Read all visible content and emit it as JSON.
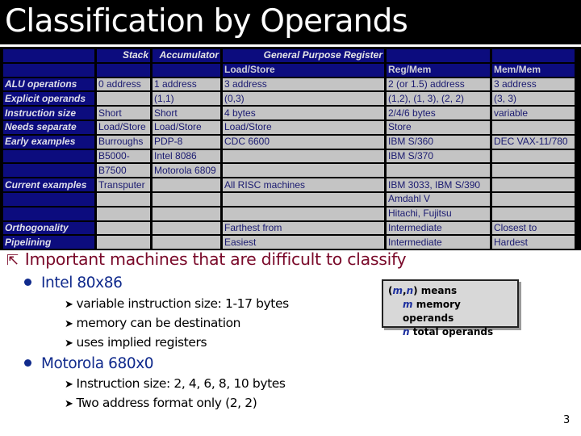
{
  "slide": {
    "title": "Classification by Operands",
    "page_number": "3"
  },
  "table": {
    "group_headers": {
      "stack": "Stack",
      "accumulator": "Accumulator",
      "gpr": "General Purpose Register"
    },
    "sub_headers": {
      "load_store": "Load/Store",
      "reg_mem": "Reg/Mem",
      "mem_mem": "Mem/Mem"
    },
    "rows": [
      {
        "label": "ALU operations",
        "cells": [
          "0 address",
          "1 address",
          "3 address",
          "2 (or 1.5) address",
          "3 address"
        ]
      },
      {
        "label": "Explicit operands",
        "cells": [
          "",
          "(1,1)",
          "(0,3)",
          "(1,2),  (1, 3), (2, 2)",
          "(3, 3)"
        ]
      },
      {
        "label": "Instruction size",
        "cells": [
          "Short",
          "Short",
          "4 bytes",
          "2/4/6 bytes",
          "variable"
        ]
      },
      {
        "label": "Needs separate",
        "cells": [
          "Load/Store",
          "Load/Store",
          "Load/Store",
          "Store",
          ""
        ]
      },
      {
        "label": "Early examples",
        "cells": [
          "Burroughs",
          "PDP-8",
          "CDC 6600",
          "IBM S/360",
          "DEC VAX-11/780"
        ]
      },
      {
        "label": "",
        "cells": [
          "B5000-",
          "Intel 8086",
          "",
          "IBM S/370",
          ""
        ]
      },
      {
        "label": "",
        "cells": [
          "B7500",
          "Motorola 6809",
          "",
          "",
          ""
        ]
      },
      {
        "label": "Current examples",
        "cells": [
          "Transputer",
          "",
          "All RISC machines",
          "IBM 3033, IBM S/390",
          ""
        ]
      },
      {
        "label": "",
        "cells": [
          "",
          "",
          "",
          "Amdahl V",
          ""
        ]
      },
      {
        "label": "",
        "cells": [
          "",
          "",
          "",
          "Hitachi, Fujitsu",
          ""
        ]
      },
      {
        "label": "Orthogonality",
        "cells": [
          "",
          "",
          "Farthest from",
          "Intermediate",
          "Closest to"
        ]
      },
      {
        "label": "Pipelining",
        "cells": [
          "",
          "",
          "Easiest",
          "Intermediate",
          "Hardest"
        ]
      }
    ]
  },
  "bullets": {
    "main_icon": "diagonal-arrow-icon",
    "main": "Important machines that are difficult to classify",
    "items": [
      {
        "label": "Intel 80x86",
        "subs": [
          "variable instruction size: 1-17 bytes",
          "memory can be destination",
          "uses implied registers"
        ]
      },
      {
        "label": "Motorola 680x0",
        "subs": [
          "Instruction size: 2, 4, 6, 8, 10 bytes",
          "Two address format only (2, 2)"
        ]
      }
    ]
  },
  "legend": {
    "open": "(",
    "m": "m",
    "comma": ",",
    "n": "n",
    "close": ")",
    "means": " means",
    "line2_var": "m",
    "line2_text": " memory operands",
    "line3_var": "n",
    "line3_text": " total operands"
  }
}
